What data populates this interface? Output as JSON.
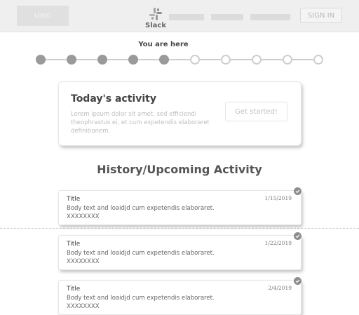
{
  "header": {
    "logo_text": "LOGO",
    "brand_label": "Slack",
    "signin_label": "SIGN IN",
    "brand_colors": [
      "#b0b0b0",
      "#9a9a9a",
      "#8a8a8a",
      "#a5a5a5"
    ]
  },
  "progress": {
    "caption": "You are here",
    "total_steps": 10,
    "current_step": 5
  },
  "activity_card": {
    "title": "Today's activity",
    "body": "Lorem ipsum dolor sit amet, sed efficiendi theophrastus ei, et cum expetendis elaboraret definitionem.",
    "button_label": "Get started!"
  },
  "section": {
    "title": "History/Upcoming Activity"
  },
  "activities": [
    {
      "title": "Title",
      "body": "Body text and loaidjd  cum expetendis elaboraret.",
      "extra": "XXXXXXXX",
      "date": "1/15/2019",
      "status_icon": "check-icon"
    },
    {
      "title": "Title",
      "body": "Body text and loaidjd  cum expetendis elaboraret.",
      "extra": "XXXXXXXX",
      "date": "1/22/2019",
      "status_icon": "check-icon"
    },
    {
      "title": "Title",
      "body": "Body text and loaidjd  cum expetendis elaboraret.",
      "extra": "XXXXXXXX",
      "date": "2/4/2019",
      "status_icon": "check-icon"
    }
  ]
}
